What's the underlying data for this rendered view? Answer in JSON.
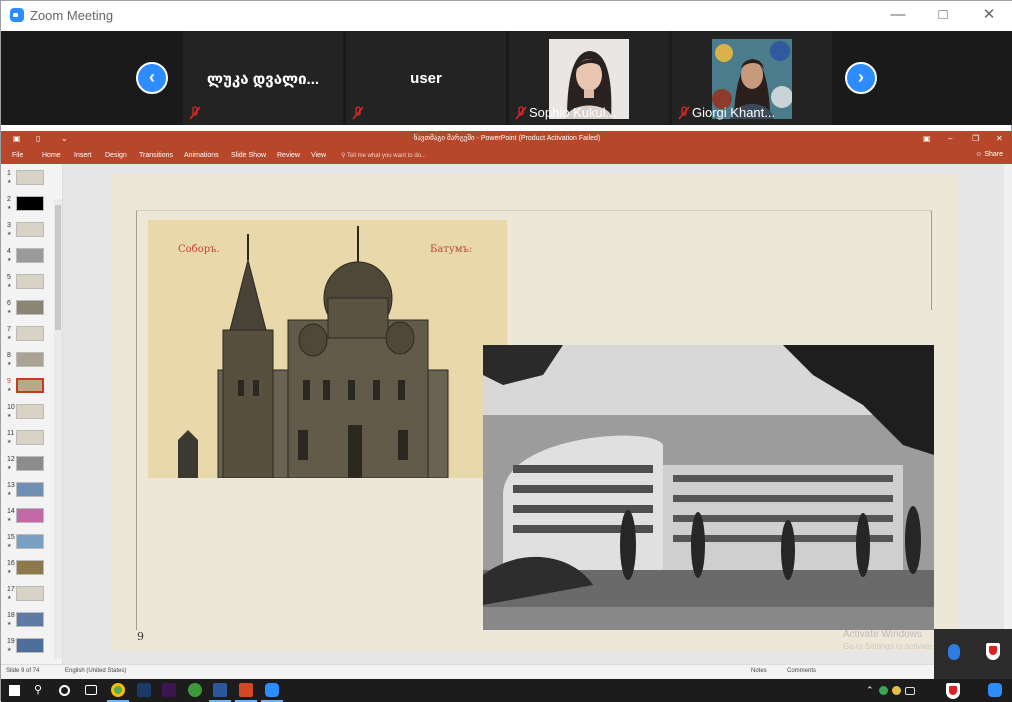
{
  "zoom": {
    "title": "Zoom Meeting",
    "participants": [
      {
        "name": "ლუკა დვალი...",
        "muted": true,
        "video": false
      },
      {
        "name": "user",
        "muted": true,
        "video": false
      },
      {
        "name": "Sophio Kukul...",
        "muted": true,
        "video": true
      },
      {
        "name": "Giorgi Khant...",
        "muted": true,
        "video": true
      }
    ]
  },
  "ppt": {
    "title": "ნავთმაგი მარგეში - PowerPoint (Product Activation Failed)",
    "tabs": [
      "File",
      "Home",
      "Insert",
      "Design",
      "Transitions",
      "Animations",
      "Slide Show",
      "Review",
      "View"
    ],
    "tell_me": "Tell me what you want to do...",
    "share": "Share",
    "slide_thumb_numbers": [
      "1",
      "2",
      "3",
      "4",
      "5",
      "6",
      "7",
      "8",
      "9",
      "10",
      "11",
      "12",
      "13",
      "14",
      "15",
      "16",
      "17",
      "18",
      "19"
    ],
    "selected_slide": "9",
    "slide": {
      "number": "9",
      "photo1_caption_left": "Соборъ.",
      "photo1_caption_right": "Батумъ:"
    },
    "status": {
      "slide_of": "Slide 9 of 74",
      "language": "English (United States)",
      "notes": "Notes",
      "comments": "Comments"
    },
    "activate_line1": "Activate Windows",
    "activate_line2": "Go to Settings to activate"
  },
  "colors": {
    "zoom_blue": "#2d8cff",
    "ppt_red": "#b7472a",
    "mute_red": "#e02828"
  }
}
